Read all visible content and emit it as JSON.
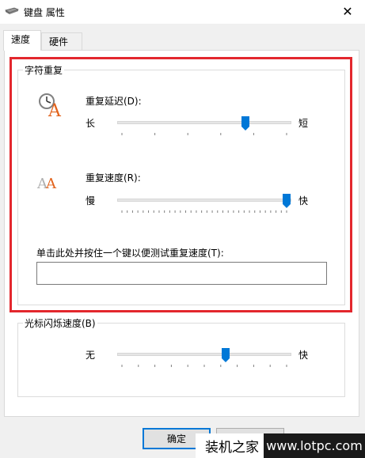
{
  "window": {
    "title": "键盘 属性",
    "close_glyph": "✕"
  },
  "tabs": [
    {
      "label": "速度",
      "selected": true
    },
    {
      "label": "硬件",
      "selected": false
    }
  ],
  "char_repeat": {
    "group_label": "字符重复",
    "delay": {
      "label": "重复延迟(D):",
      "min_label": "长",
      "max_label": "短",
      "value": 0.75
    },
    "rate": {
      "label": "重复速度(R):",
      "min_label": "慢",
      "max_label": "快",
      "value": 1.0
    },
    "test": {
      "label": "单击此处并按住一个键以便测试重复速度(T):",
      "value": ""
    }
  },
  "cursor_blink": {
    "group_label": "光标闪烁速度(B)",
    "min_label": "无",
    "max_label": "快",
    "value": 0.63
  },
  "buttons": {
    "ok": "确定"
  },
  "watermark": {
    "text": "装机之家",
    "url": "www.lotpc.com"
  },
  "colors": {
    "highlight": "#e3272d",
    "thumb": "#0078d7"
  }
}
